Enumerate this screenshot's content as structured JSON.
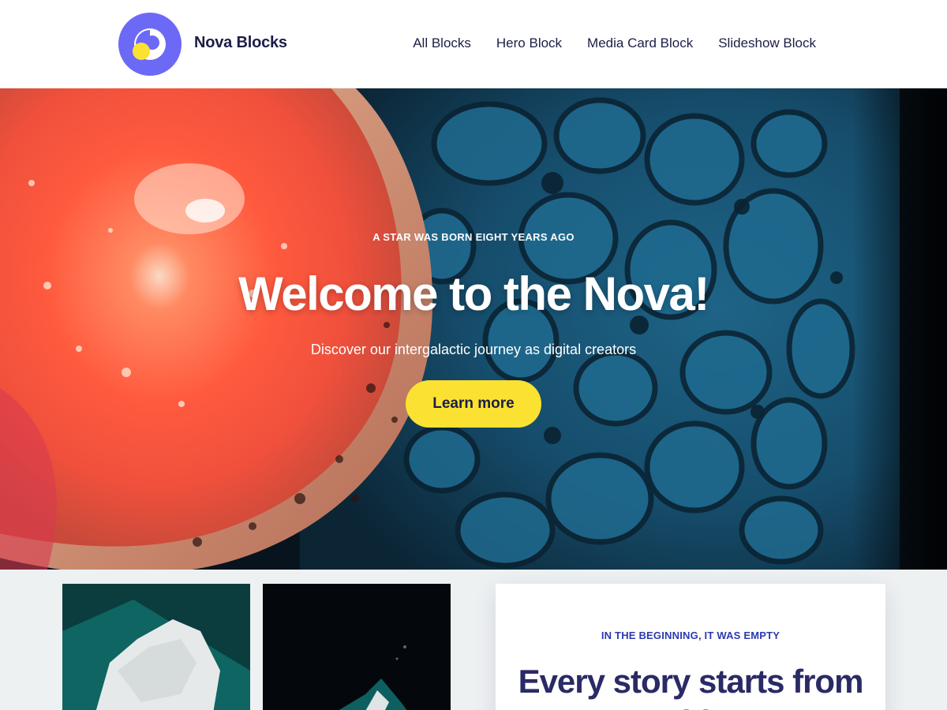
{
  "header": {
    "site_title": "Nova Blocks",
    "logo": {
      "icon": "nova-logo-icon",
      "bg_color": "#6c69f6",
      "dot_color": "#fbe232"
    },
    "nav": [
      {
        "label": "All Blocks"
      },
      {
        "label": "Hero Block"
      },
      {
        "label": "Media Card Block"
      },
      {
        "label": "Slideshow Block"
      }
    ]
  },
  "hero": {
    "eyebrow": "A STAR WAS BORN EIGHT YEARS AGO",
    "title": "Welcome to the Nova!",
    "subtitle": "Discover our intergalactic journey as digital creators",
    "button_label": "Learn more",
    "button_color": "#fbe232",
    "image": "abstract-fluid-art-image"
  },
  "media_card": {
    "eyebrow": "IN THE BEGINNING, IT WAS EMPTY",
    "title": "Every story starts from nothing",
    "eyebrow_color": "#2c3ab0",
    "title_color": "#2a2a66"
  },
  "colors": {
    "text_dark": "#1c1d47",
    "section_bg": "#eef1f2"
  }
}
